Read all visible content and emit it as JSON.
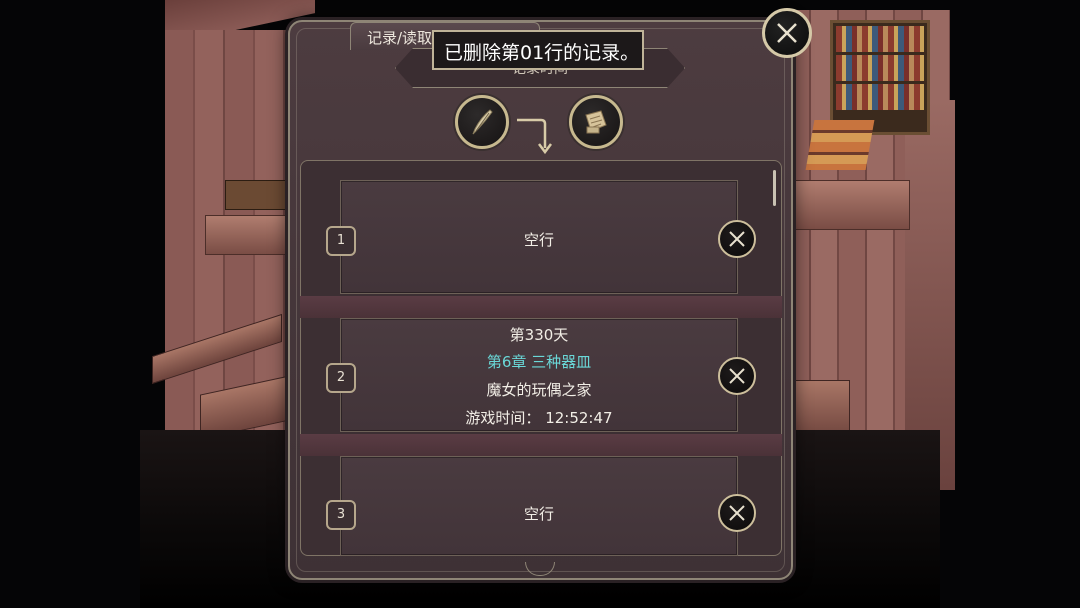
{
  "panel": {
    "tab_title": "记录/读取",
    "time_label": "记录时间",
    "toast": "已删除第01行的记录。",
    "icons": {
      "write": "quill-icon",
      "read": "scroll-icon",
      "close": "close-icon"
    }
  },
  "slots": [
    {
      "number": "1",
      "empty_text": "空行"
    },
    {
      "number": "2",
      "day": "第330天",
      "chapter": "第6章 三种器皿",
      "location": "魔女的玩偶之家",
      "play_time": "游戏时间： 12:52:47"
    },
    {
      "number": "3",
      "empty_text": "空行"
    }
  ],
  "colors": {
    "chapter": "#6ad8d8",
    "frame_gold": "#c7b98f",
    "panel": "#45363a"
  }
}
